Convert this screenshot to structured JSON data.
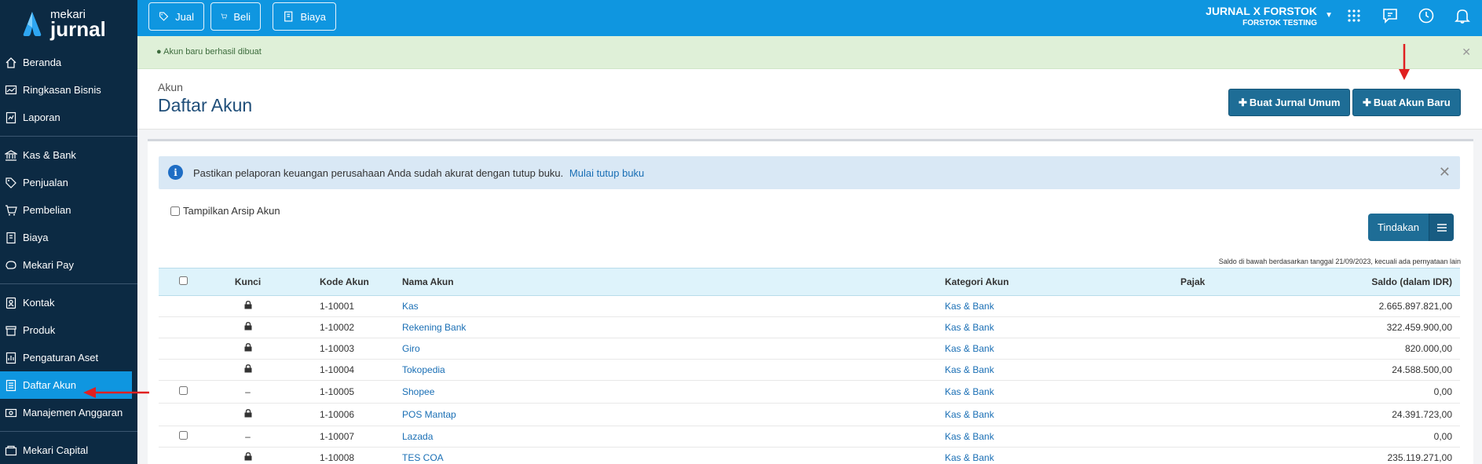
{
  "brand": {
    "small": "mekari",
    "big": "jurnal"
  },
  "sidebar": {
    "items": [
      {
        "label": "Beranda",
        "icon": "home-icon"
      },
      {
        "label": "Ringkasan Bisnis",
        "icon": "chart-icon"
      },
      {
        "label": "Laporan",
        "icon": "report-icon"
      },
      {
        "label": "Kas & Bank",
        "icon": "bank-icon"
      },
      {
        "label": "Penjualan",
        "icon": "tag-icon"
      },
      {
        "label": "Pembelian",
        "icon": "cart-icon"
      },
      {
        "label": "Biaya",
        "icon": "receipt-icon"
      },
      {
        "label": "Mekari Pay",
        "icon": "pay-icon"
      },
      {
        "label": "Kontak",
        "icon": "contact-icon"
      },
      {
        "label": "Produk",
        "icon": "product-icon"
      },
      {
        "label": "Pengaturan Aset",
        "icon": "asset-icon"
      },
      {
        "label": "Daftar Akun",
        "icon": "list-icon"
      },
      {
        "label": "Manajemen Anggaran",
        "icon": "budget-icon"
      },
      {
        "label": "Mekari Capital",
        "icon": "capital-icon"
      }
    ]
  },
  "topbar": {
    "jual": "Jual",
    "beli": "Beli",
    "biaya": "Biaya",
    "company_name": "JURNAL X FORSTOK",
    "company_sub": "FORSTOK TESTING"
  },
  "alert": {
    "text": "Akun baru berhasil dibuat"
  },
  "header": {
    "crumb": "Akun",
    "title": "Daftar Akun",
    "btn_jurnal": "Buat Jurnal Umum",
    "btn_akun": "Buat Akun Baru"
  },
  "info": {
    "text": "Pastikan pelaporan keuangan perusahaan Anda sudah akurat dengan tutup buku.",
    "link": "Mulai tutup buku"
  },
  "archive_label": "Tampilkan Arsip Akun",
  "tindakan": "Tindakan",
  "saldo_note": "Saldo di bawah berdasarkan tanggal 21/09/2023, kecuali ada pernyataan lain",
  "table": {
    "headers": {
      "kunci": "Kunci",
      "kode": "Kode Akun",
      "nama": "Nama Akun",
      "kategori": "Kategori Akun",
      "pajak": "Pajak",
      "saldo": "Saldo (dalam IDR)"
    },
    "rows": [
      {
        "locked": true,
        "kode": "1-10001",
        "nama": "Kas",
        "kategori": "Kas & Bank",
        "pajak": "",
        "saldo": "2.665.897.821,00"
      },
      {
        "locked": true,
        "kode": "1-10002",
        "nama": "Rekening Bank",
        "kategori": "Kas & Bank",
        "pajak": "",
        "saldo": "322.459.900,00"
      },
      {
        "locked": true,
        "kode": "1-10003",
        "nama": "Giro",
        "kategori": "Kas & Bank",
        "pajak": "",
        "saldo": "820.000,00"
      },
      {
        "locked": true,
        "kode": "1-10004",
        "nama": "Tokopedia",
        "kategori": "Kas & Bank",
        "pajak": "",
        "saldo": "24.588.500,00"
      },
      {
        "locked": false,
        "kode": "1-10005",
        "nama": "Shopee",
        "kategori": "Kas & Bank",
        "pajak": "",
        "saldo": "0,00"
      },
      {
        "locked": true,
        "kode": "1-10006",
        "nama": "POS Mantap",
        "kategori": "Kas & Bank",
        "pajak": "",
        "saldo": "24.391.723,00"
      },
      {
        "locked": false,
        "kode": "1-10007",
        "nama": "Lazada",
        "kategori": "Kas & Bank",
        "pajak": "",
        "saldo": "0,00"
      },
      {
        "locked": true,
        "kode": "1-10008",
        "nama": "TES COA",
        "kategori": "Kas & Bank",
        "pajak": "",
        "saldo": "235.119.271,00"
      }
    ]
  },
  "colors": {
    "sidebar": "#0c2a43",
    "topbar": "#0f96e0",
    "primary_btn": "#1e6d96",
    "annotation": "#e02020"
  }
}
